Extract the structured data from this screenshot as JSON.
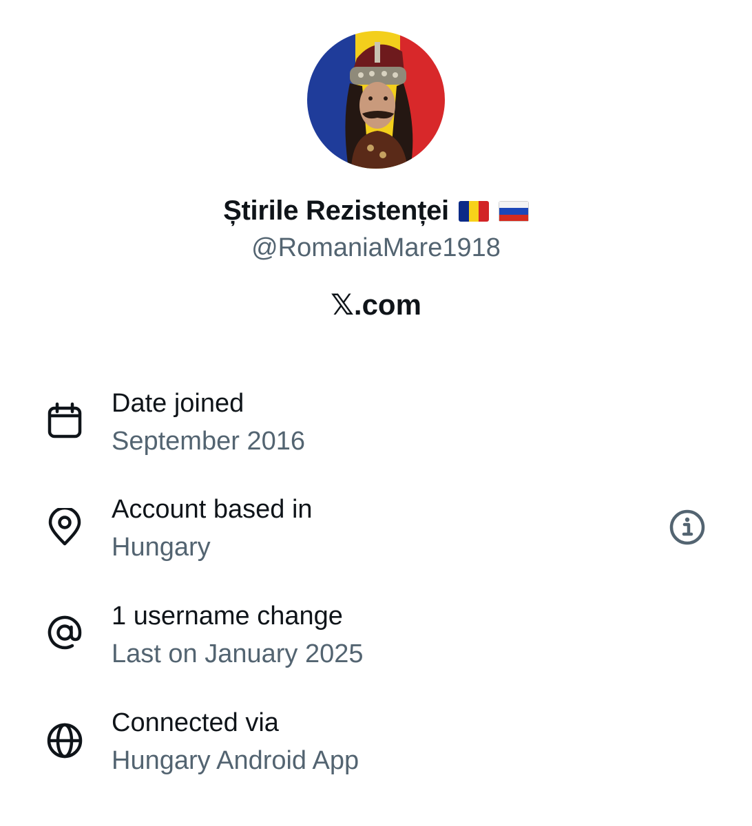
{
  "profile": {
    "display_name": "Știrile Rezistenței",
    "handle": "@RomaniaMare1918",
    "site": "𝕏.com",
    "flags": [
      "romania-flag",
      "russia-flag"
    ]
  },
  "details": [
    {
      "icon": "calendar-icon",
      "title": "Date joined",
      "value": "September 2016"
    },
    {
      "icon": "location-pin-icon",
      "title": "Account based in",
      "value": "Hungary"
    },
    {
      "icon": "at-sign-icon",
      "title": "1 username change",
      "value": "Last on January 2025"
    },
    {
      "icon": "globe-icon",
      "title": "Connected via",
      "value": "Hungary Android App"
    }
  ],
  "colors": {
    "primary_text": "#0f1419",
    "secondary_text": "#536471",
    "romania_blue": "#0b2a87",
    "romania_yellow": "#f7d11a",
    "romania_red": "#d22426"
  }
}
